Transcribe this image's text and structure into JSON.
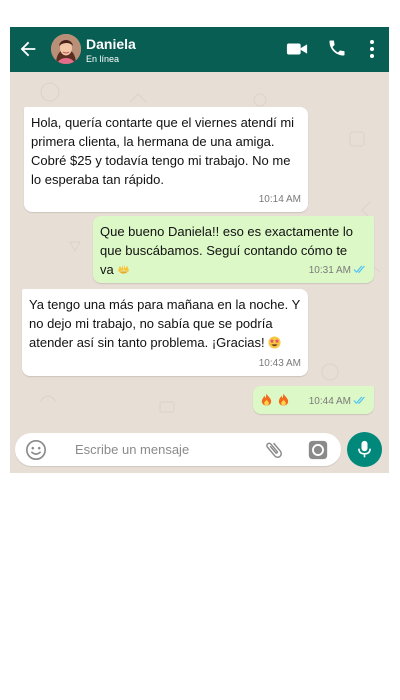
{
  "header": {
    "contact_name": "Daniela",
    "status": "En línea",
    "icons": [
      "back-arrow-icon",
      "video-call-icon",
      "phone-icon",
      "more-vertical-icon"
    ]
  },
  "messages": [
    {
      "direction": "incoming",
      "text": "Hola, quería contarte que el viernes atendí mi primera clienta, la hermana de una amiga. Cobré $25 y todavía tengo mi trabajo. No me lo esperaba tan rápido.",
      "time": "10:14 AM"
    },
    {
      "direction": "outgoing",
      "text": "Que bueno Daniela!! eso es exactamente lo que buscábamos. Seguí contando cómo te va",
      "emoji": "raised-hands-emoji",
      "time": "10:31 AM",
      "read": true
    },
    {
      "direction": "incoming",
      "text": "Ya tengo una más para mañana en la noche. Y no dejo mi trabajo, no sabía que se podría atender así sin tanto problema. ¡Gracias!",
      "emoji": "star-struck-emoji",
      "time": "10:43 AM"
    },
    {
      "direction": "outgoing",
      "text": "",
      "emoji": "fire-emoji fire-emoji",
      "time": "10:44 AM",
      "read": true
    }
  ],
  "composer": {
    "placeholder": "Escribe un mensaje",
    "icons": [
      "smiley-icon",
      "paperclip-icon",
      "camera-icon",
      "microphone-icon"
    ]
  },
  "colors": {
    "header": "#095e54",
    "chat_background": "#e7ded5",
    "outgoing_bubble": "#dcf8c6",
    "incoming_bubble": "#ffffff",
    "read_ticks": "#4fc3f7",
    "mic_button": "#00897b"
  }
}
